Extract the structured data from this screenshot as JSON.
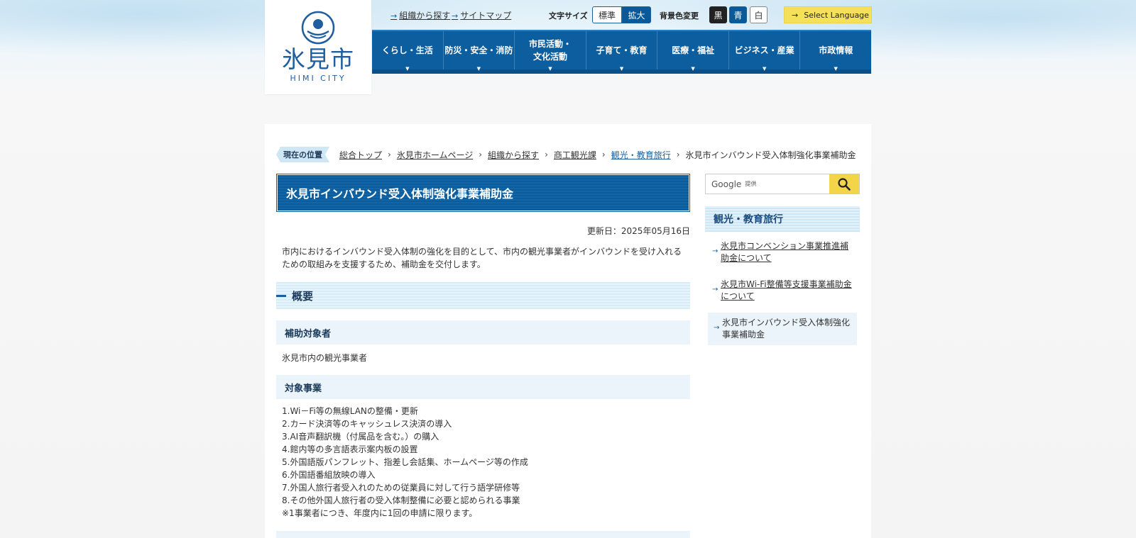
{
  "logo": {
    "name": "氷見市",
    "sub": "HIMI CITY"
  },
  "utility": {
    "org_link": "組織から探す",
    "sitemap_link": "サイトマップ",
    "font_size_label": "文字サイズ",
    "font_standard": "標準",
    "font_large": "拡大",
    "bg_color_label": "背景色変更",
    "bg_black": "黒",
    "bg_blue": "青",
    "bg_white": "白",
    "language": "Select Language"
  },
  "nav": [
    {
      "label1": "くらし・生活",
      "label2": ""
    },
    {
      "label1": "防災・安全・消防",
      "label2": ""
    },
    {
      "label1": "市民活動・",
      "label2": "文化活動"
    },
    {
      "label1": "子育て・教育",
      "label2": ""
    },
    {
      "label1": "医療・福祉",
      "label2": ""
    },
    {
      "label1": "ビジネス・産業",
      "label2": ""
    },
    {
      "label1": "市政情報",
      "label2": ""
    }
  ],
  "breadcrumb": {
    "here_label": "現在の位置",
    "items": [
      "総合トップ",
      "氷見市ホームページ",
      "組織から探す",
      "商工観光課",
      "観光・教育旅行"
    ],
    "current": "氷見市インバウンド受入体制強化事業補助金"
  },
  "page": {
    "title": "氷見市インバウンド受入体制強化事業補助金",
    "updated": "更新日：2025年05月16日",
    "lead": "市内におけるインバウンド受入体制の強化を目的として、市内の観光事業者がインバウンドを受け入れるための取組みを支援するため、補助金を交付します。",
    "section_title": "概要",
    "target_heading": "補助対象者",
    "target_text": "氷見市内の観光事業者",
    "project_heading": "対象事業",
    "project_items": [
      "1.Wi－Fi等の無線LANの整備・更新",
      "2.カード決済等のキャッシュレス決済の導入",
      "3.AI音声翻訳機（付属品を含む。）の購入",
      "4.館内等の多言語表示案内板の設置",
      "5.外国語版パンフレット、指差し会話集、ホームページ等の作成",
      "6.外国語番組放映の導入",
      "7.外国人旅行者受入れのための従業員に対して行う語学研修等",
      "8.その他外国人旅行者の受入体制整備に必要と認められる事業",
      "※1事業者につき、年度内に1回の申請に限ります。"
    ]
  },
  "side": {
    "search_provider": "Google",
    "search_suffix": "提供",
    "heading": "観光・教育旅行",
    "links": [
      "氷見市コンベンション事業推進補助金について",
      "氷見市Wi-Fi整備等支援事業補助金について",
      "氷見市インバウンド受入体制強化事業補助金"
    ]
  },
  "colors": {
    "primary": "#0d5e9f",
    "accent_yellow": "#f3d54a",
    "light_blue": "#eaf4fa"
  }
}
